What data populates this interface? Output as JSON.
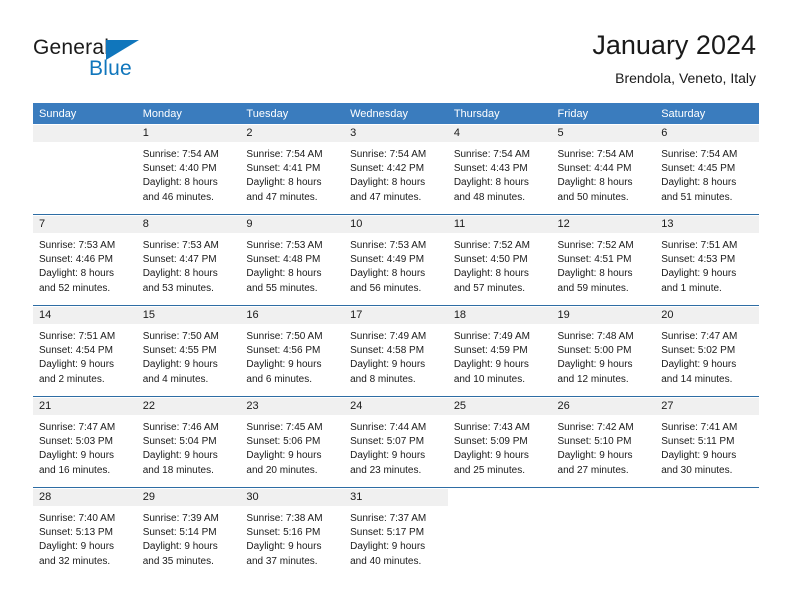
{
  "brand": {
    "word1": "General",
    "word2": "Blue",
    "accent_color": "#1076bc",
    "logo_icon": "triangle-flag-icon"
  },
  "header": {
    "title": "January 2024",
    "subtitle": "Brendola, Veneto, Italy"
  },
  "calendar": {
    "header_color": "#3a7cbe",
    "weekdays": [
      "Sunday",
      "Monday",
      "Tuesday",
      "Wednesday",
      "Thursday",
      "Friday",
      "Saturday"
    ],
    "weeks": [
      [
        {
          "day": "",
          "lines": []
        },
        {
          "day": "1",
          "lines": [
            "Sunrise: 7:54 AM",
            "Sunset: 4:40 PM",
            "Daylight: 8 hours",
            "and 46 minutes."
          ]
        },
        {
          "day": "2",
          "lines": [
            "Sunrise: 7:54 AM",
            "Sunset: 4:41 PM",
            "Daylight: 8 hours",
            "and 47 minutes."
          ]
        },
        {
          "day": "3",
          "lines": [
            "Sunrise: 7:54 AM",
            "Sunset: 4:42 PM",
            "Daylight: 8 hours",
            "and 47 minutes."
          ]
        },
        {
          "day": "4",
          "lines": [
            "Sunrise: 7:54 AM",
            "Sunset: 4:43 PM",
            "Daylight: 8 hours",
            "and 48 minutes."
          ]
        },
        {
          "day": "5",
          "lines": [
            "Sunrise: 7:54 AM",
            "Sunset: 4:44 PM",
            "Daylight: 8 hours",
            "and 50 minutes."
          ]
        },
        {
          "day": "6",
          "lines": [
            "Sunrise: 7:54 AM",
            "Sunset: 4:45 PM",
            "Daylight: 8 hours",
            "and 51 minutes."
          ]
        }
      ],
      [
        {
          "day": "7",
          "lines": [
            "Sunrise: 7:53 AM",
            "Sunset: 4:46 PM",
            "Daylight: 8 hours",
            "and 52 minutes."
          ]
        },
        {
          "day": "8",
          "lines": [
            "Sunrise: 7:53 AM",
            "Sunset: 4:47 PM",
            "Daylight: 8 hours",
            "and 53 minutes."
          ]
        },
        {
          "day": "9",
          "lines": [
            "Sunrise: 7:53 AM",
            "Sunset: 4:48 PM",
            "Daylight: 8 hours",
            "and 55 minutes."
          ]
        },
        {
          "day": "10",
          "lines": [
            "Sunrise: 7:53 AM",
            "Sunset: 4:49 PM",
            "Daylight: 8 hours",
            "and 56 minutes."
          ]
        },
        {
          "day": "11",
          "lines": [
            "Sunrise: 7:52 AM",
            "Sunset: 4:50 PM",
            "Daylight: 8 hours",
            "and 57 minutes."
          ]
        },
        {
          "day": "12",
          "lines": [
            "Sunrise: 7:52 AM",
            "Sunset: 4:51 PM",
            "Daylight: 8 hours",
            "and 59 minutes."
          ]
        },
        {
          "day": "13",
          "lines": [
            "Sunrise: 7:51 AM",
            "Sunset: 4:53 PM",
            "Daylight: 9 hours",
            "and 1 minute."
          ]
        }
      ],
      [
        {
          "day": "14",
          "lines": [
            "Sunrise: 7:51 AM",
            "Sunset: 4:54 PM",
            "Daylight: 9 hours",
            "and 2 minutes."
          ]
        },
        {
          "day": "15",
          "lines": [
            "Sunrise: 7:50 AM",
            "Sunset: 4:55 PM",
            "Daylight: 9 hours",
            "and 4 minutes."
          ]
        },
        {
          "day": "16",
          "lines": [
            "Sunrise: 7:50 AM",
            "Sunset: 4:56 PM",
            "Daylight: 9 hours",
            "and 6 minutes."
          ]
        },
        {
          "day": "17",
          "lines": [
            "Sunrise: 7:49 AM",
            "Sunset: 4:58 PM",
            "Daylight: 9 hours",
            "and 8 minutes."
          ]
        },
        {
          "day": "18",
          "lines": [
            "Sunrise: 7:49 AM",
            "Sunset: 4:59 PM",
            "Daylight: 9 hours",
            "and 10 minutes."
          ]
        },
        {
          "day": "19",
          "lines": [
            "Sunrise: 7:48 AM",
            "Sunset: 5:00 PM",
            "Daylight: 9 hours",
            "and 12 minutes."
          ]
        },
        {
          "day": "20",
          "lines": [
            "Sunrise: 7:47 AM",
            "Sunset: 5:02 PM",
            "Daylight: 9 hours",
            "and 14 minutes."
          ]
        }
      ],
      [
        {
          "day": "21",
          "lines": [
            "Sunrise: 7:47 AM",
            "Sunset: 5:03 PM",
            "Daylight: 9 hours",
            "and 16 minutes."
          ]
        },
        {
          "day": "22",
          "lines": [
            "Sunrise: 7:46 AM",
            "Sunset: 5:04 PM",
            "Daylight: 9 hours",
            "and 18 minutes."
          ]
        },
        {
          "day": "23",
          "lines": [
            "Sunrise: 7:45 AM",
            "Sunset: 5:06 PM",
            "Daylight: 9 hours",
            "and 20 minutes."
          ]
        },
        {
          "day": "24",
          "lines": [
            "Sunrise: 7:44 AM",
            "Sunset: 5:07 PM",
            "Daylight: 9 hours",
            "and 23 minutes."
          ]
        },
        {
          "day": "25",
          "lines": [
            "Sunrise: 7:43 AM",
            "Sunset: 5:09 PM",
            "Daylight: 9 hours",
            "and 25 minutes."
          ]
        },
        {
          "day": "26",
          "lines": [
            "Sunrise: 7:42 AM",
            "Sunset: 5:10 PM",
            "Daylight: 9 hours",
            "and 27 minutes."
          ]
        },
        {
          "day": "27",
          "lines": [
            "Sunrise: 7:41 AM",
            "Sunset: 5:11 PM",
            "Daylight: 9 hours",
            "and 30 minutes."
          ]
        }
      ],
      [
        {
          "day": "28",
          "lines": [
            "Sunrise: 7:40 AM",
            "Sunset: 5:13 PM",
            "Daylight: 9 hours",
            "and 32 minutes."
          ]
        },
        {
          "day": "29",
          "lines": [
            "Sunrise: 7:39 AM",
            "Sunset: 5:14 PM",
            "Daylight: 9 hours",
            "and 35 minutes."
          ]
        },
        {
          "day": "30",
          "lines": [
            "Sunrise: 7:38 AM",
            "Sunset: 5:16 PM",
            "Daylight: 9 hours",
            "and 37 minutes."
          ]
        },
        {
          "day": "31",
          "lines": [
            "Sunrise: 7:37 AM",
            "Sunset: 5:17 PM",
            "Daylight: 9 hours",
            "and 40 minutes."
          ]
        },
        {
          "day": "",
          "lines": []
        },
        {
          "day": "",
          "lines": []
        },
        {
          "day": "",
          "lines": []
        }
      ]
    ]
  }
}
